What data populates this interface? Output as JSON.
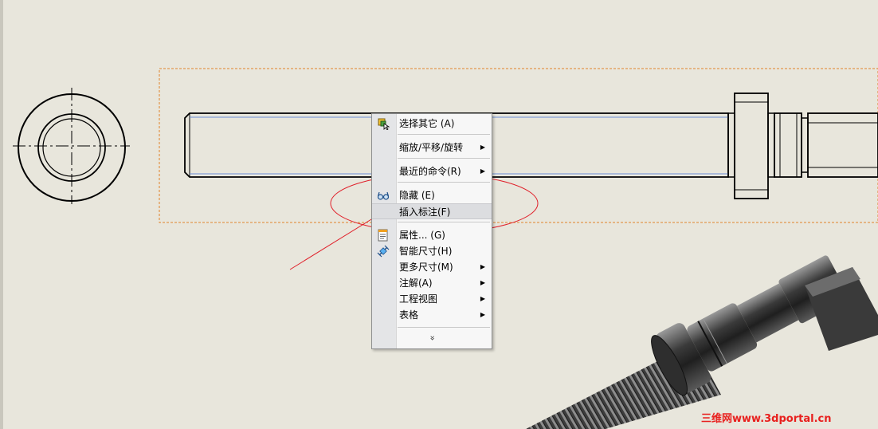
{
  "context_menu": {
    "items": [
      {
        "label": "选择其它 (A)",
        "icon": "select-other-icon",
        "submenu": false
      },
      {
        "label": "缩放/平移/旋转",
        "icon": "",
        "submenu": true
      },
      {
        "label": "最近的命令(R)",
        "icon": "",
        "submenu": true
      },
      {
        "label": "隐藏 (E)",
        "icon": "hide-glasses-icon",
        "submenu": false
      },
      {
        "label": "插入标注(F)",
        "icon": "",
        "submenu": false,
        "highlighted": true
      },
      {
        "label": "属性... (G)",
        "icon": "properties-icon",
        "submenu": false
      },
      {
        "label": "智能尺寸(H)",
        "icon": "smart-dimension-icon",
        "submenu": false
      },
      {
        "label": "更多尺寸(M)",
        "icon": "",
        "submenu": true
      },
      {
        "label": "注解(A)",
        "icon": "",
        "submenu": true
      },
      {
        "label": "工程视图",
        "icon": "",
        "submenu": true
      },
      {
        "label": "表格",
        "icon": "",
        "submenu": true
      }
    ],
    "more_symbol": "»"
  },
  "watermark": "三维网www.3dportal.cn",
  "colors": {
    "background": "#e8e6dc",
    "selection_box": "#e0842c",
    "annotation_red": "#e0202a",
    "edge_blue": "#6b8fd6",
    "menu_highlight": "#dcdde0"
  }
}
